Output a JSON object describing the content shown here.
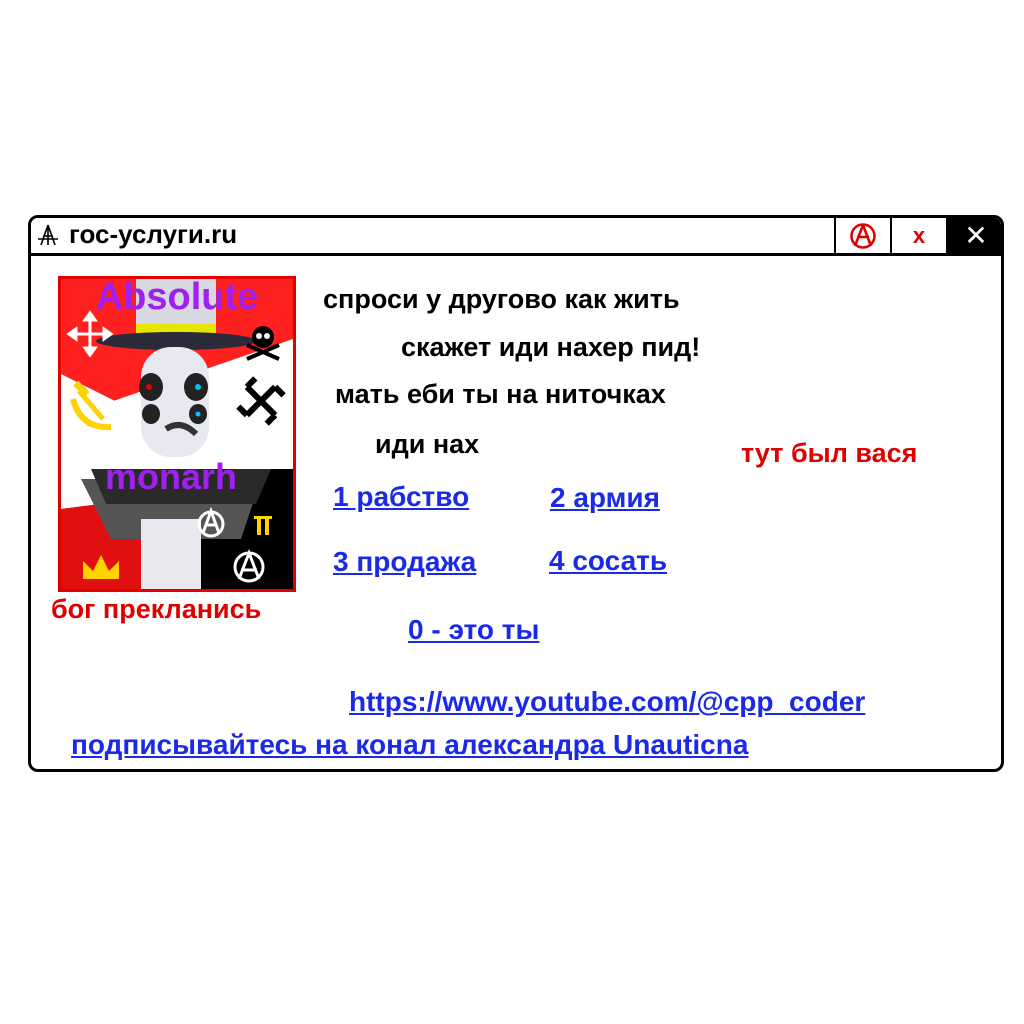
{
  "window": {
    "title": "гос-услуги.ru",
    "icons": {
      "app": "anarchy-compass-icon",
      "anarchy_button": "anarchy-icon",
      "close": "close-icon"
    },
    "buttons": {
      "x_label": "x",
      "close_label": "✕"
    }
  },
  "portrait": {
    "top_text": "Absolute",
    "mid_text": "monarh",
    "caption": "бог прекланись",
    "icons": [
      "move-arrows-icon",
      "hammer-sickle-icon",
      "skull-crossbones-icon",
      "swastika-icon",
      "crown-icon",
      "anarchy-icon",
      "pause-icon",
      "tripod-symbol-icon"
    ]
  },
  "messages": {
    "line1": "спроси у другово как жить",
    "line2": "скажет иди нахер пид!",
    "line3": "мать еби ты на ниточках",
    "line4": "иди нах",
    "side_note": "тут был вася"
  },
  "options": {
    "opt1": "1 рабство",
    "opt2": "2 армия",
    "opt3": "3 продажа",
    "opt4": "4 сосать",
    "opt0": "0 - это ты"
  },
  "links": {
    "youtube": "https://www.youtube.com/@cpp_coder",
    "subscribe": "подписывайтесь на конал александра Unauticna"
  },
  "colors": {
    "link": "#1a2ae6",
    "red": "#e00000",
    "purple": "#a020f0",
    "black": "#000000"
  }
}
